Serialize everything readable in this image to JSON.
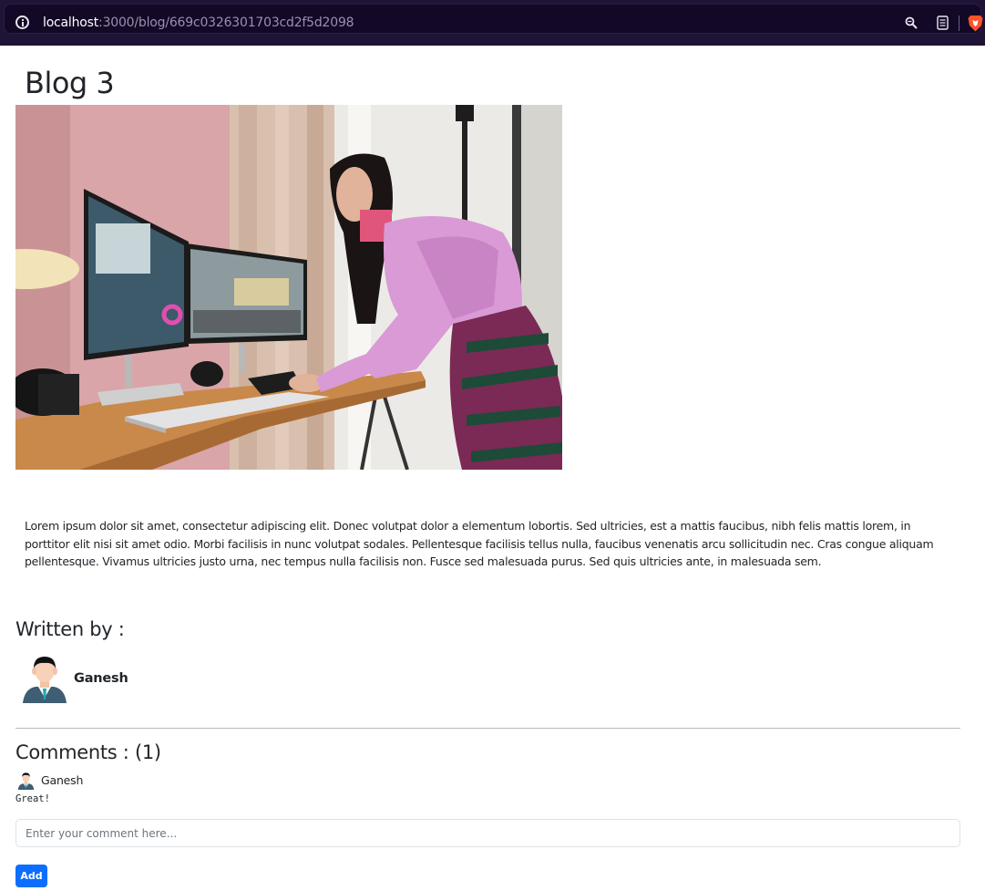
{
  "browser": {
    "url_host": "localhost",
    "url_path": ":3000/blog/669c0326301703cd2f5d2098",
    "icons": [
      "info-icon",
      "zoom-icon",
      "reader-mode-icon",
      "brave-shield-icon"
    ]
  },
  "blog": {
    "title": "Blog 3",
    "image_alt": "hero-photo",
    "body": "Lorem ipsum dolor sit amet, consectetur adipiscing elit. Donec volutpat dolor a elementum lobortis. Sed ultricies, est a mattis faucibus, nibh felis mattis lorem, in porttitor elit nisi sit amet odio. Morbi facilisis in nunc volutpat sodales. Pellentesque facilisis tellus nulla, faucibus venenatis arcu sollicitudin nec. Cras congue aliquam pellentesque. Vivamus ultricies justo urna, nec tempus nulla facilisis non. Fusce sed malesuada purus. Sed quis ultricies ante, in malesuada sem."
  },
  "author": {
    "heading": "Written by :",
    "name": "Ganesh"
  },
  "comments": {
    "heading": "Comments : (1)",
    "items": [
      {
        "author": "Ganesh",
        "text": "Great!"
      }
    ],
    "input_placeholder": "Enter your comment here...",
    "add_label": "Add"
  },
  "colors": {
    "browser_bar": "#201436",
    "accent": "#0d6efd",
    "text": "#212529"
  }
}
